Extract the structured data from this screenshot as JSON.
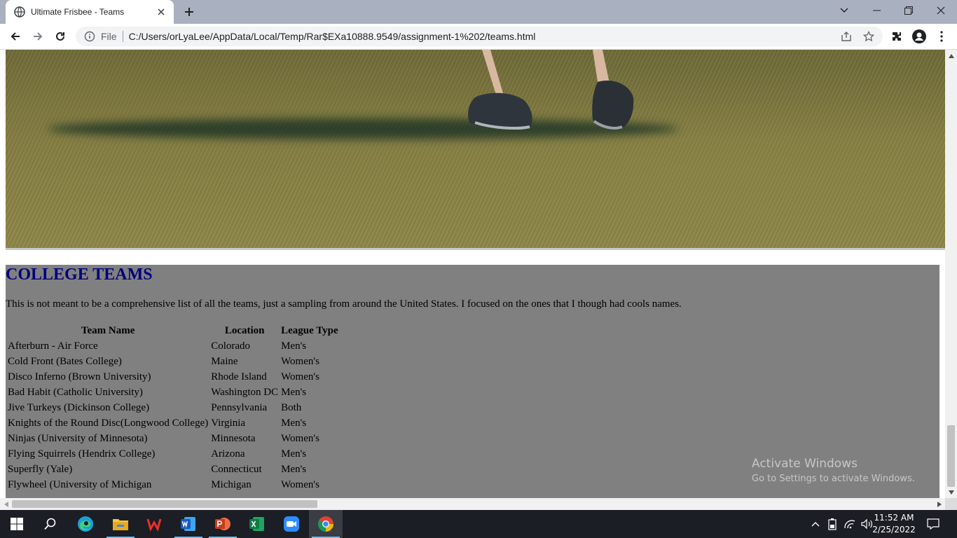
{
  "browser": {
    "tab_title": "Ultimate Frisbee - Teams",
    "scheme_label": "File",
    "url": "C:/Users/orLyaLee/AppData/Local/Temp/Rar$EXa10888.9549/assignment-1%202/teams.html"
  },
  "page": {
    "heading": "COLLEGE TEAMS",
    "intro": "This is not meant to be a comprehensive list of all the teams, just a sampling from around the United States. I focused on the ones that I though had cools names.",
    "table": {
      "headers": [
        "Team Name",
        "Location",
        "League Type"
      ],
      "rows": [
        [
          "Afterburn - Air Force",
          "Colorado",
          "Men's"
        ],
        [
          "Cold Front (Bates College)",
          "Maine",
          "Women's"
        ],
        [
          "Disco Inferno (Brown University)",
          "Rhode Island",
          "Women's"
        ],
        [
          "Bad Habit (Catholic University)",
          "Washington DC",
          "Men's"
        ],
        [
          "Jive Turkeys (Dickinson College)",
          "Pennsylvania",
          "Both"
        ],
        [
          "Knights of the Round Disc(Longwood College)",
          "Virginia",
          "Men's"
        ],
        [
          "Ninjas (University of Minnesota)",
          "Minnesota",
          "Women's"
        ],
        [
          "Flying Squirrels (Hendrix College)",
          "Arizona",
          "Men's"
        ],
        [
          "Superfly (Yale)",
          "Connecticut",
          "Men's"
        ],
        [
          "Flywheel (University of Michigan",
          "Michigan",
          "Women's"
        ]
      ]
    }
  },
  "watermark": {
    "line1": "Activate Windows",
    "line2": "Go to Settings to activate Windows."
  },
  "taskbar": {
    "apps": [
      "start",
      "search",
      "edge",
      "file-explorer",
      "wps",
      "word",
      "powerpoint",
      "excel",
      "zoom",
      "chrome"
    ],
    "time": "11:52 AM",
    "date": "2/25/2022"
  },
  "colors": {
    "heading": "#000080",
    "section_bg": "#808080",
    "tabstrip": "#a9b1c0",
    "taskbar": "#1b1e24"
  }
}
